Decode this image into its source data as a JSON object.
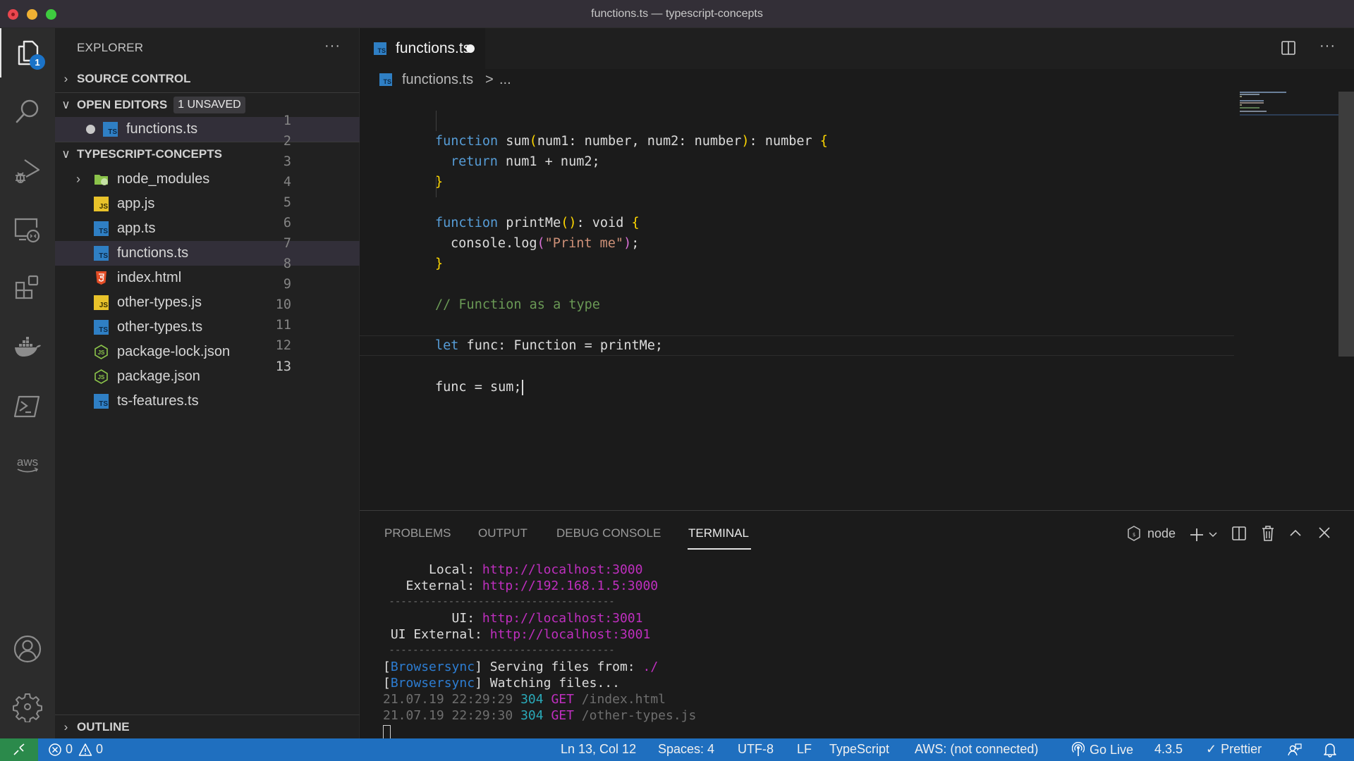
{
  "window": {
    "title": "functions.ts — typescript-concepts"
  },
  "activity_bar": {
    "items": [
      {
        "name": "explorer",
        "icon": "files-icon",
        "badge": "1",
        "active": true
      },
      {
        "name": "search",
        "icon": "search-icon"
      },
      {
        "name": "run-debug",
        "icon": "run-debug-icon"
      },
      {
        "name": "remote-explorer",
        "icon": "remote-explorer-icon"
      },
      {
        "name": "extensions",
        "icon": "extensions-icon"
      },
      {
        "name": "docker",
        "icon": "docker-icon"
      },
      {
        "name": "powershell",
        "icon": "terminal-icon"
      },
      {
        "name": "aws",
        "icon": "aws-icon"
      }
    ],
    "bottom": [
      {
        "name": "accounts",
        "icon": "account-icon"
      },
      {
        "name": "manage",
        "icon": "gear-icon"
      }
    ]
  },
  "sidebar": {
    "title": "EXPLORER",
    "more_label": "···",
    "sections": {
      "source_control": {
        "label": "SOURCE CONTROL",
        "expanded": false
      },
      "open_editors": {
        "label": "OPEN EDITORS",
        "badge": "1 UNSAVED",
        "expanded": true,
        "files": [
          {
            "name": "functions.ts",
            "type": "ts",
            "dirty": true
          }
        ]
      },
      "project": {
        "label": "TYPESCRIPT-CONCEPTS",
        "expanded": true,
        "items": [
          {
            "name": "node_modules",
            "type": "folder",
            "expanded": false
          },
          {
            "name": "app.js",
            "type": "js"
          },
          {
            "name": "app.ts",
            "type": "ts"
          },
          {
            "name": "functions.ts",
            "type": "ts",
            "selected": true
          },
          {
            "name": "index.html",
            "type": "html"
          },
          {
            "name": "other-types.js",
            "type": "js"
          },
          {
            "name": "other-types.ts",
            "type": "ts"
          },
          {
            "name": "package-lock.json",
            "type": "json"
          },
          {
            "name": "package.json",
            "type": "json"
          },
          {
            "name": "ts-features.ts",
            "type": "ts"
          }
        ]
      },
      "outline": {
        "label": "OUTLINE",
        "expanded": false
      }
    }
  },
  "editor": {
    "tab": {
      "label": "functions.ts",
      "icon_text": "TS",
      "dirty": true
    },
    "breadcrumb": {
      "file": "functions.ts",
      "separator": ">",
      "more": "..."
    },
    "lines": [
      {
        "n": "1"
      },
      {
        "n": "2"
      },
      {
        "n": "3"
      },
      {
        "n": "4"
      },
      {
        "n": "5"
      },
      {
        "n": "6"
      },
      {
        "n": "7"
      },
      {
        "n": "8"
      },
      {
        "n": "9"
      },
      {
        "n": "10"
      },
      {
        "n": "11"
      },
      {
        "n": "12"
      },
      {
        "n": "13"
      }
    ],
    "code": {
      "l1": {
        "kw": "function",
        "name": " sum",
        "open": "(",
        "params": "num1: number, num2: number",
        "close": ")",
        "ret": ": number ",
        "brace": "{"
      },
      "l2": {
        "kw": "return",
        "rest": " num1 + num2;"
      },
      "l3": {
        "brace": "}"
      },
      "l5": {
        "kw": "function",
        "name": " printMe",
        "open": "(",
        "close": ")",
        "ret": ": void ",
        "brace": "{"
      },
      "l6": {
        "pre": "console.log",
        "open": "(",
        "str": "\"Print me\"",
        "close": ")",
        "post": ";"
      },
      "l7": {
        "brace": "}"
      },
      "l9": {
        "comment": "// Function as a type"
      },
      "l11": {
        "kw": "let",
        "rest": " func: Function = printMe;"
      },
      "l13": {
        "text": "func = sum;"
      }
    },
    "current_line": 13
  },
  "panel": {
    "tabs": [
      {
        "label": "PROBLEMS"
      },
      {
        "label": "OUTPUT"
      },
      {
        "label": "DEBUG CONSOLE"
      },
      {
        "label": "TERMINAL",
        "active": true
      }
    ],
    "terminal_select": "node",
    "terminal": {
      "local_label": "      Local: ",
      "local_url": "http://localhost:3000",
      "external_label": "   External: ",
      "external_url": "http://192.168.1.5:3000",
      "divider": " --------------------------------------",
      "ui_label": "         UI: ",
      "ui_url": "http://localhost:3001",
      "ui_external_label": " UI External: ",
      "ui_external_url": "http://localhost:3001",
      "bs_tag": "Browsersync",
      "serving_text": " Serving files from: ",
      "serving_path": "./",
      "watching_text": " Watching files...",
      "log": [
        {
          "time": "21.07.19 22:29:29",
          "status": "304",
          "method": "GET",
          "path": "/index.html"
        },
        {
          "time": "21.07.19 22:29:30",
          "status": "304",
          "method": "GET",
          "path": "/other-types.js"
        }
      ]
    }
  },
  "status_bar": {
    "errors": "0",
    "warnings": "0",
    "position": "Ln 13, Col 12",
    "spaces": "Spaces: 4",
    "encoding": "UTF-8",
    "eol": "LF",
    "language": "TypeScript",
    "aws": "AWS: (not connected)",
    "go_live": "Go Live",
    "ts_version": "4.3.5",
    "prettier": "Prettier",
    "colors": {
      "background": "#1f6fbf",
      "remote": "#2b8a4b"
    }
  }
}
